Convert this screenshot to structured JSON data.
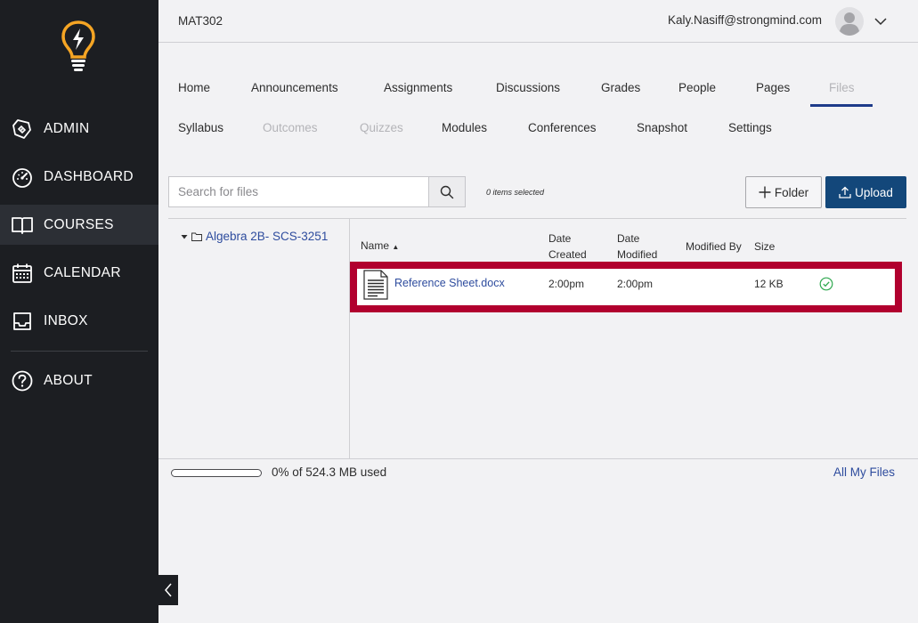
{
  "sidebar": {
    "items": [
      {
        "label": "ADMIN",
        "icon": "admin-shield-icon",
        "active": false
      },
      {
        "label": "DASHBOARD",
        "icon": "speedometer-icon",
        "active": false
      },
      {
        "label": "COURSES",
        "icon": "open-book-icon",
        "active": true
      },
      {
        "label": "CALENDAR",
        "icon": "calendar-icon",
        "active": false
      },
      {
        "label": "INBOX",
        "icon": "inbox-tray-icon",
        "active": false
      },
      {
        "label": "ABOUT",
        "icon": "question-circle-icon",
        "active": false
      }
    ]
  },
  "header": {
    "course_code": "MAT302",
    "user_email": "Kaly.Nasiff@strongmind.com"
  },
  "tabs": {
    "row1": [
      {
        "label": "Home",
        "disabled": false
      },
      {
        "label": "Announcements",
        "disabled": false
      },
      {
        "label": "Assignments",
        "disabled": false
      },
      {
        "label": "Discussions",
        "disabled": false
      },
      {
        "label": "Grades",
        "disabled": false
      },
      {
        "label": "People",
        "disabled": false
      },
      {
        "label": "Pages",
        "disabled": false
      },
      {
        "label": "Files",
        "disabled": true,
        "active": true
      }
    ],
    "row2": [
      {
        "label": "Syllabus",
        "disabled": false
      },
      {
        "label": "Outcomes",
        "disabled": true
      },
      {
        "label": "Quizzes",
        "disabled": true
      },
      {
        "label": "Modules",
        "disabled": false
      },
      {
        "label": "Conferences",
        "disabled": false
      },
      {
        "label": "Snapshot",
        "disabled": false
      },
      {
        "label": "Settings",
        "disabled": false
      }
    ]
  },
  "toolbar": {
    "search_placeholder": "Search for files",
    "items_selected": "0 items selected",
    "folder_label": "Folder",
    "upload_label": "Upload"
  },
  "tree": {
    "root_folder": "Algebra 2B- SCS-3251"
  },
  "table": {
    "columns": {
      "name": "Name",
      "sort_indicator": "▲",
      "date_created_1": "Date",
      "date_created_2": "Created",
      "date_modified_1": "Date",
      "date_modified_2": "Modified",
      "modified_by": "Modified By",
      "size": "Size"
    },
    "rows": [
      {
        "name": "Reference Sheet.docx",
        "date_created": "2:00pm",
        "date_modified": "2:00pm",
        "modified_by": "",
        "size": "12 KB",
        "status": "published-check-icon"
      }
    ]
  },
  "footer": {
    "quota_used_fraction": 0.0,
    "quota_text": "0% of 524.3 MB used",
    "all_files_label": "All My Files"
  },
  "colors": {
    "sidebar_bg": "#1c1e22",
    "accent": "#13477a",
    "link": "#2e4c9e",
    "highlight": "#b1002e",
    "logo": "#f5a524",
    "success": "#2fa84f"
  }
}
